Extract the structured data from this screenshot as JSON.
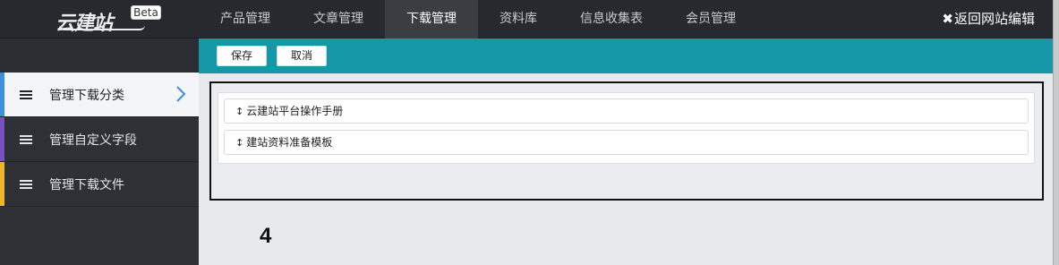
{
  "brand": {
    "logo_text": "云建站",
    "badge": "Beta"
  },
  "nav": {
    "items": [
      {
        "label": "产品管理",
        "active": false
      },
      {
        "label": "文章管理",
        "active": false
      },
      {
        "label": "下载管理",
        "active": true
      },
      {
        "label": "资料库",
        "active": false
      },
      {
        "label": "信息收集表",
        "active": false
      },
      {
        "label": "会员管理",
        "active": false
      }
    ],
    "back_icon": "✖",
    "back_label": "返回网站编辑"
  },
  "sidebar": {
    "items": [
      {
        "label": "管理下载分类",
        "active": true,
        "accent": "#3b8fe0",
        "icon": "menu-icon"
      },
      {
        "label": "管理自定义字段",
        "active": false,
        "accent": "#7a4fc2",
        "icon": "menu-icon"
      },
      {
        "label": "管理下载文件",
        "active": false,
        "accent": "#f0b429",
        "icon": "menu-icon"
      }
    ]
  },
  "toolbar": {
    "save_label": "保存",
    "cancel_label": "取消"
  },
  "categories": {
    "handle_icon": "↕",
    "rows": [
      {
        "label": "云建站平台操作手册"
      },
      {
        "label": "建站资料准备模板"
      }
    ]
  },
  "annotation": {
    "number": "4"
  },
  "colors": {
    "topbar": "#262a2e",
    "toolbar": "#1597a7",
    "sidebar": "#2d3035",
    "chevron": "#3b8fe0"
  }
}
